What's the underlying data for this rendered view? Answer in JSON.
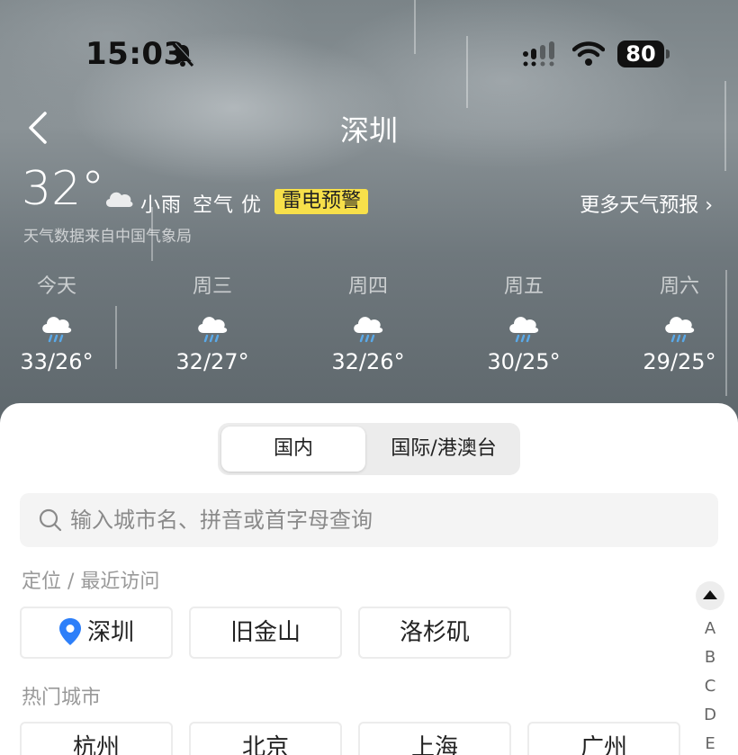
{
  "status_bar": {
    "time": "15:03",
    "battery": "80"
  },
  "header": {
    "city": "深圳"
  },
  "current": {
    "temperature": "32°",
    "condition": "小雨",
    "air_quality": "空气 优",
    "alert": "雷电预警",
    "more_forecast": "更多天气预报 ›",
    "source": "天气数据来自中国气象局"
  },
  "forecast": [
    {
      "day": "今天",
      "temps": "33/26°"
    },
    {
      "day": "周三",
      "temps": "32/27°"
    },
    {
      "day": "周四",
      "temps": "32/26°"
    },
    {
      "day": "周五",
      "temps": "30/25°"
    },
    {
      "day": "周六",
      "temps": "29/25°"
    }
  ],
  "tabs": {
    "domestic": "国内",
    "international": "国际/港澳台",
    "active": "domestic"
  },
  "search": {
    "placeholder": "输入城市名、拼音或首字母查询"
  },
  "recent": {
    "label": "定位 / 最近访问",
    "cities": [
      "深圳",
      "旧金山",
      "洛杉矶"
    ]
  },
  "hot": {
    "label": "热门城市",
    "cities": [
      "杭州",
      "北京",
      "上海",
      "广州"
    ]
  },
  "index_letters": [
    "A",
    "B",
    "C",
    "D",
    "E"
  ]
}
